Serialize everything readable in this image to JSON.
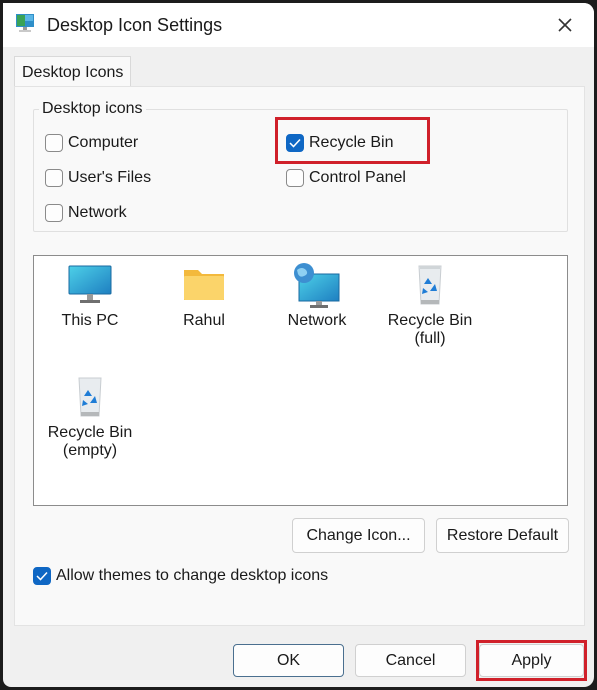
{
  "window": {
    "title": "Desktop Icon Settings"
  },
  "tabs": [
    {
      "label": "Desktop Icons",
      "active": true
    }
  ],
  "group": {
    "label": "Desktop icons",
    "checkboxes": [
      {
        "label": "Computer",
        "checked": false
      },
      {
        "label": "Recycle Bin",
        "checked": true,
        "highlighted": true
      },
      {
        "label": "User's Files",
        "checked": false
      },
      {
        "label": "Control Panel",
        "checked": false
      },
      {
        "label": "Network",
        "checked": false
      }
    ]
  },
  "icons": [
    {
      "label": "This PC",
      "icon": "monitor-icon"
    },
    {
      "label": "Rahul",
      "icon": "folder-icon"
    },
    {
      "label": "Network",
      "icon": "network-icon"
    },
    {
      "label": "Recycle Bin\n(full)",
      "line1": "Recycle Bin",
      "line2": "(full)",
      "icon": "recycle-bin-full-icon"
    },
    {
      "label": "Recycle Bin\n(empty)",
      "line1": "Recycle Bin",
      "line2": "(empty)",
      "icon": "recycle-bin-empty-icon"
    }
  ],
  "buttons": {
    "change_icon": "Change Icon...",
    "restore_default": "Restore Default",
    "ok": "OK",
    "cancel": "Cancel",
    "apply": "Apply"
  },
  "allow_themes": {
    "label": "Allow themes to change desktop icons",
    "checked": true
  },
  "colors": {
    "accent": "#0f67c4",
    "highlight": "#d0202a"
  }
}
